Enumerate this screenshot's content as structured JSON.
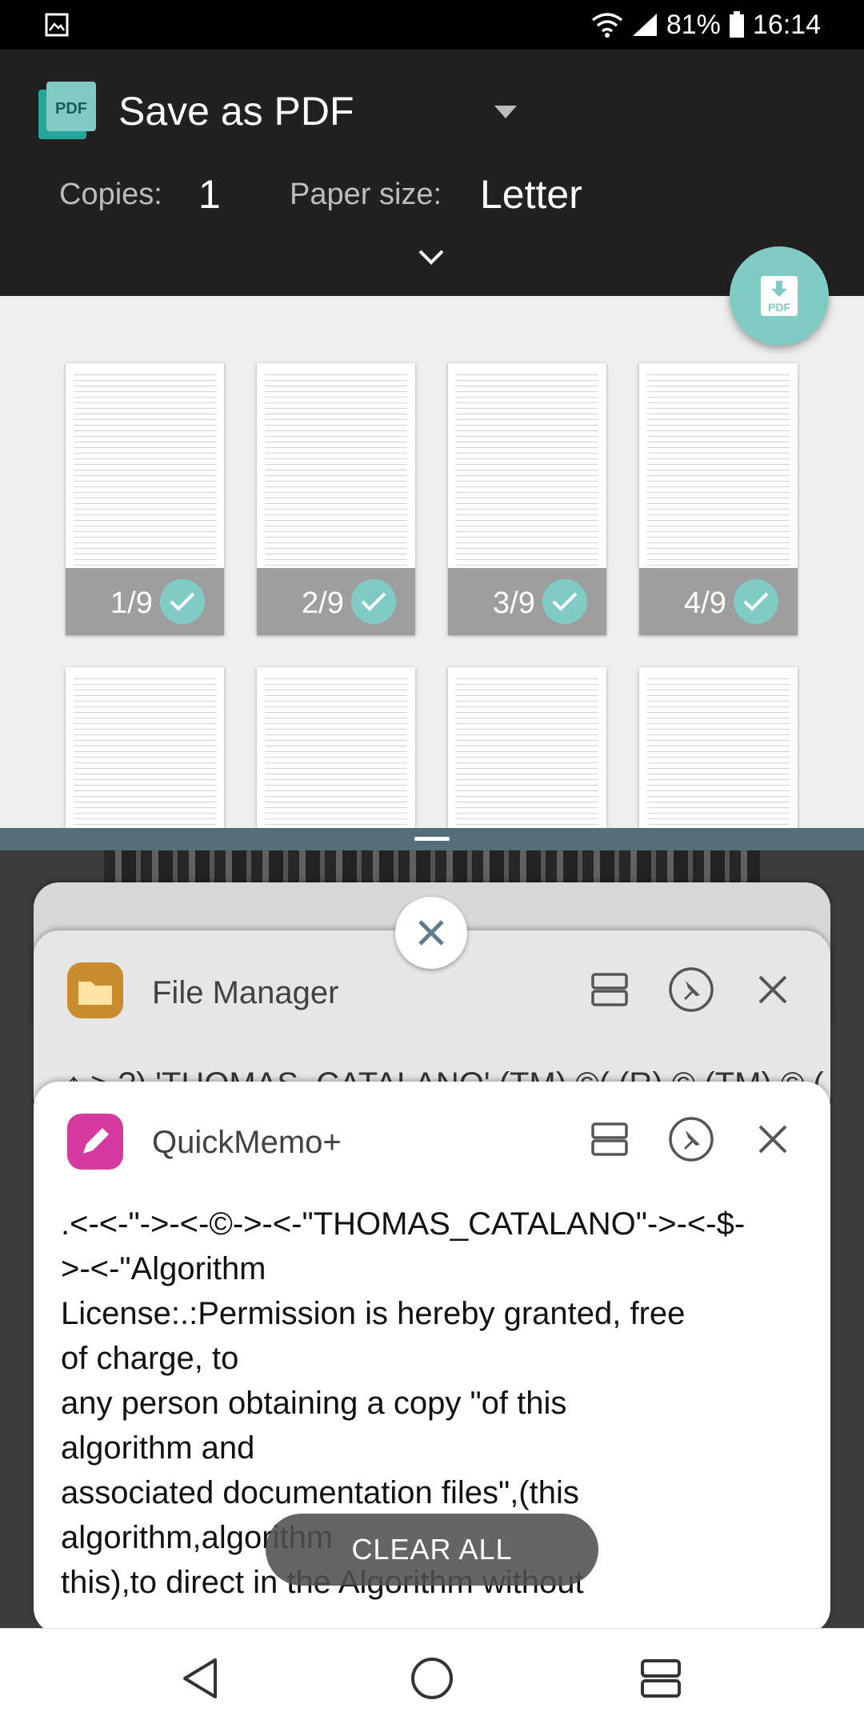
{
  "status_bar": {
    "battery": "81%",
    "time": "16:14",
    "icons": [
      "gallery-icon",
      "wifi-icon",
      "signal-icon",
      "battery-icon"
    ]
  },
  "print_header": {
    "printer_name": "Save as PDF",
    "copies_label": "Copies:",
    "copies_value": "1",
    "paper_size_label": "Paper size:",
    "paper_size_value": "Letter",
    "accent_color": "#80cbc4"
  },
  "preview": {
    "pages": [
      {
        "label": "1/9",
        "selected": true
      },
      {
        "label": "2/9",
        "selected": true
      },
      {
        "label": "3/9",
        "selected": true
      },
      {
        "label": "4/9",
        "selected": true
      }
    ]
  },
  "recents": {
    "file_manager": {
      "title": "File Manager",
      "preview_text": "↑  > ?) 'THOMAS_CATALANO' (TM) ©( (R) © (TM)  © ("
    },
    "quickmemo": {
      "title": "QuickMemo+",
      "lines": [
        ".<-<-\"->-<-©->-<-\"THOMAS_CATALANO\"->-<-$-",
        ">-<-\"Algorithm",
        "License:.:Permission is hereby granted, free",
        "of charge, to",
        "any person obtaining a copy \"of this",
        "algorithm and",
        "associated documentation files\",(this",
        "algorithm,algorithm",
        "this),to direct in the Algorithm without"
      ]
    },
    "clear_all_label": "CLEAR ALL"
  }
}
